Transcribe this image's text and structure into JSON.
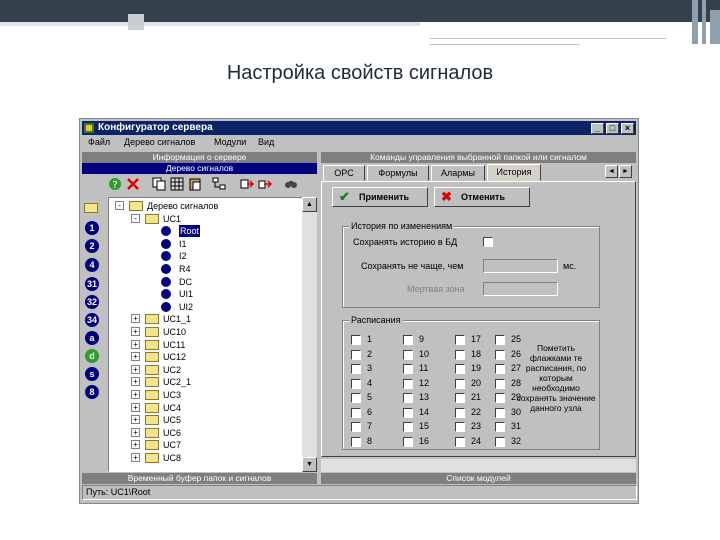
{
  "slide_title": "Настройка свойств сигналов",
  "window": {
    "title": "Конфигуратор сервера",
    "min_glyph": "_",
    "max_glyph": "□",
    "close_glyph": "×"
  },
  "menu": [
    "Файл",
    "Дерево сигналов",
    "Модули",
    "Вид"
  ],
  "left_header_top": "Информация о сервере",
  "left_header_tree": "Дерево сигналов",
  "right_header": "Команды управления выбранной папкой или сигналом",
  "toolbar_icons": [
    "help-icon",
    "delete-icon",
    "copy-icon",
    "grid-icon",
    "paste-icon",
    "tree-icon",
    "move-icon",
    "export-icon",
    "find-icon"
  ],
  "side_icons": [
    "1",
    "2",
    "4",
    "31",
    "32",
    "34",
    "a",
    "d",
    "s",
    "8"
  ],
  "tree": [
    {
      "label": "Дерево сигналов",
      "level": 0,
      "expander": "-",
      "kind": "folder"
    },
    {
      "label": "UC1",
      "level": 1,
      "expander": "-",
      "kind": "folder"
    },
    {
      "label": "Root",
      "level": 2,
      "kind": "signal",
      "selected": true
    },
    {
      "label": "I1",
      "level": 2,
      "kind": "signal"
    },
    {
      "label": "I2",
      "level": 2,
      "kind": "signal"
    },
    {
      "label": "R4",
      "level": 2,
      "kind": "signal"
    },
    {
      "label": "DC",
      "level": 2,
      "kind": "signal"
    },
    {
      "label": "UI1",
      "level": 2,
      "kind": "signal"
    },
    {
      "label": "UI2",
      "level": 2,
      "kind": "signal"
    },
    {
      "label": "UC1_1",
      "level": 1,
      "expander": "+",
      "kind": "folder"
    },
    {
      "label": "UC10",
      "level": 1,
      "expander": "+",
      "kind": "folder"
    },
    {
      "label": "UC11",
      "level": 1,
      "expander": "+",
      "kind": "folder"
    },
    {
      "label": "UC12",
      "level": 1,
      "expander": "+",
      "kind": "folder"
    },
    {
      "label": "UC2",
      "level": 1,
      "expander": "+",
      "kind": "folder"
    },
    {
      "label": "UC2_1",
      "level": 1,
      "expander": "+",
      "kind": "folder"
    },
    {
      "label": "UC3",
      "level": 1,
      "expander": "+",
      "kind": "folder"
    },
    {
      "label": "UC4",
      "level": 1,
      "expander": "+",
      "kind": "folder"
    },
    {
      "label": "UC5",
      "level": 1,
      "expander": "+",
      "kind": "folder"
    },
    {
      "label": "UC6",
      "level": 1,
      "expander": "+",
      "kind": "folder"
    },
    {
      "label": "UC7",
      "level": 1,
      "expander": "+",
      "kind": "folder"
    },
    {
      "label": "UC8",
      "level": 1,
      "expander": "+",
      "kind": "folder"
    }
  ],
  "tabs": [
    "OPC",
    "Формулы",
    "Алармы",
    "История"
  ],
  "active_tab": 3,
  "apply_label": "Применить",
  "cancel_label": "Отменить",
  "history_group": {
    "title": "История по изменениям",
    "save_history_label": "Сохранять историю в БД",
    "save_history_checked": false,
    "interval_label": "Сохранять не чаще, чем",
    "interval_value": "",
    "unit": "мс.",
    "deadband_label": "Мертвая зона",
    "deadband_value": ""
  },
  "schedules_group": {
    "title": "Расписания",
    "columns": [
      [
        "1",
        "2",
        "3",
        "4",
        "5",
        "6",
        "7",
        "8"
      ],
      [
        "9",
        "10",
        "11",
        "12",
        "13",
        "14",
        "15",
        "16"
      ],
      [
        "17",
        "18",
        "19",
        "20",
        "21",
        "22",
        "23",
        "24"
      ],
      [
        "25",
        "26",
        "27",
        "28",
        "29",
        "30",
        "31",
        "32"
      ]
    ],
    "hint_lines": [
      "Пометить",
      "флажками те",
      "расписания, по",
      "которым",
      "необходимо",
      "сохранять значение",
      "данного узла"
    ]
  },
  "left_footer": "Временный буфер папок и сигналов",
  "right_footer": "Список модулей",
  "status": "Путь: UC1\\Root"
}
